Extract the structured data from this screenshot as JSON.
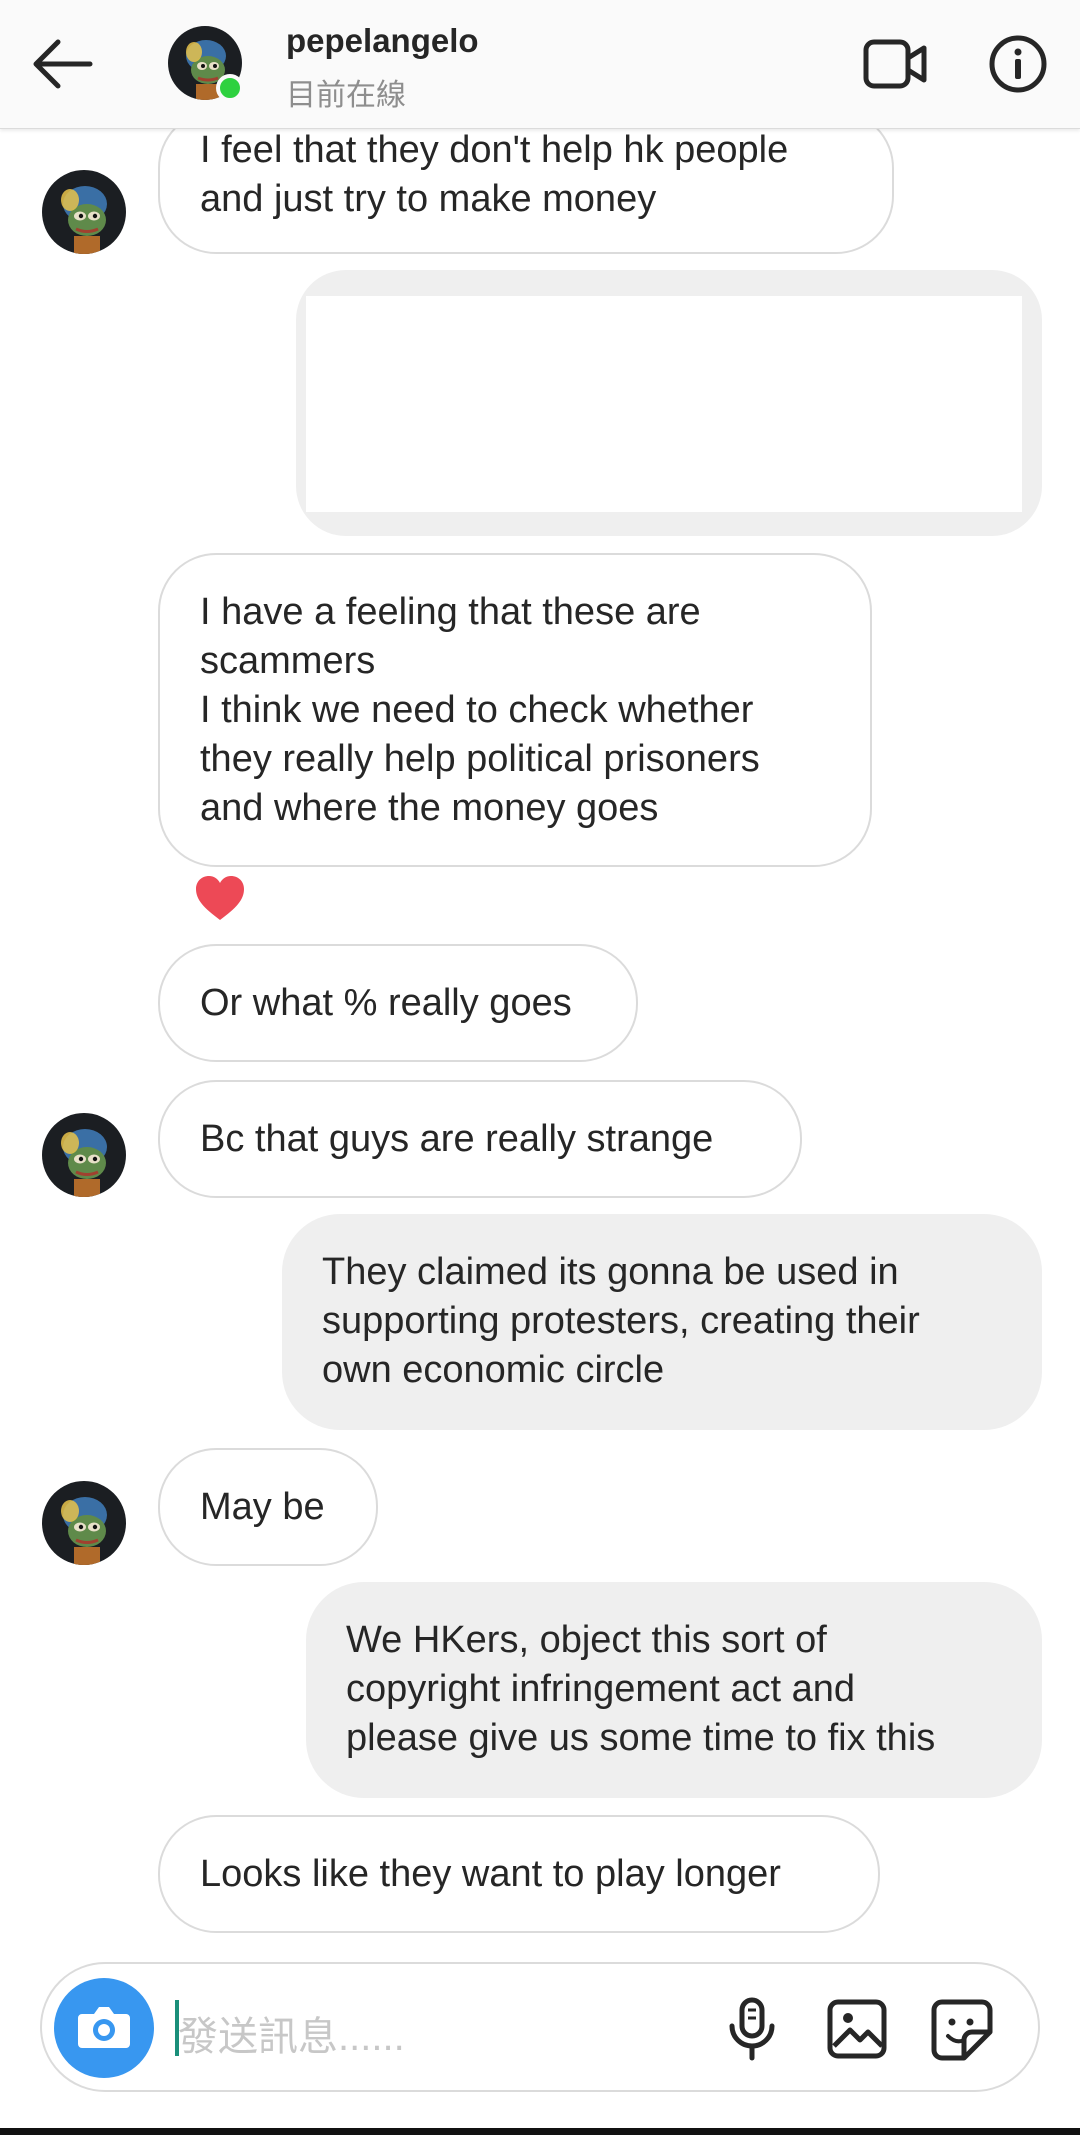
{
  "header": {
    "username": "pepelangelo",
    "status": "目前在線"
  },
  "messages": [
    {
      "from": "them",
      "text": "I feel that they don't help hk people\nand just try to make money"
    },
    {
      "from": "them",
      "text": "I have a feeling that these are\nscammers\nI think we need to check whether\nthey really help political prisoners\nand where the money goes"
    },
    {
      "from": "them",
      "text": "Or what % really goes"
    },
    {
      "from": "them",
      "text": "Bc that guys are really strange"
    },
    {
      "from": "me",
      "text": "They claimed its gonna be used in\nsupporting protesters, creating their\nown economic circle"
    },
    {
      "from": "them",
      "text": "May be"
    },
    {
      "from": "me",
      "text": "We HKers, object this sort of\ncopyright infringement act and\nplease give us some time to fix this"
    },
    {
      "from": "them",
      "text": "Looks like they want to play longer"
    }
  ],
  "composer": {
    "placeholder": "發送訊息......"
  },
  "icons": {
    "back": "arrow-left-icon",
    "video": "video-call-icon",
    "info": "info-icon",
    "camera": "camera-icon",
    "mic": "microphone-icon",
    "gallery": "image-icon",
    "sticker": "sticker-icon",
    "reaction": "heart-icon"
  },
  "colors": {
    "online": "#2ed13f",
    "camera_button": "#3897f0",
    "heart": "#ed4956",
    "sent_bubble": "#efefef"
  }
}
